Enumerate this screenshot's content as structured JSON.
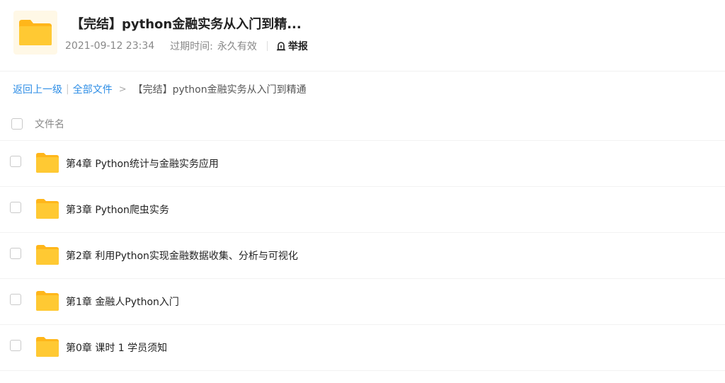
{
  "share": {
    "title": "【完结】python金融实务从入门到精...",
    "date": "2021-09-12 23:34",
    "expire_label": "过期时间:",
    "expire_value": "永久有效",
    "report_label": "举报"
  },
  "breadcrumb": {
    "back": "返回上一级",
    "all_files": "全部文件",
    "separator": ">",
    "current": "【完结】python金融实务从入门到精通"
  },
  "list": {
    "header": "文件名",
    "rows": [
      {
        "name": "第4章 Python统计与金融实务应用",
        "icon": "folder-icon"
      },
      {
        "name": "第3章 Python爬虫实务",
        "icon": "folder-icon"
      },
      {
        "name": "第2章 利用Python实现金融数据收集、分析与可视化",
        "icon": "folder-icon"
      },
      {
        "name": "第1章 金融人Python入门",
        "icon": "folder-icon"
      },
      {
        "name": "第0章 课时 1 学员须知",
        "icon": "folder-icon"
      }
    ]
  },
  "colors": {
    "link": "#2e8ee6",
    "folder": "#ffc933",
    "folder_tab": "#ffb61a",
    "icon_bg": "#fff8e6"
  }
}
